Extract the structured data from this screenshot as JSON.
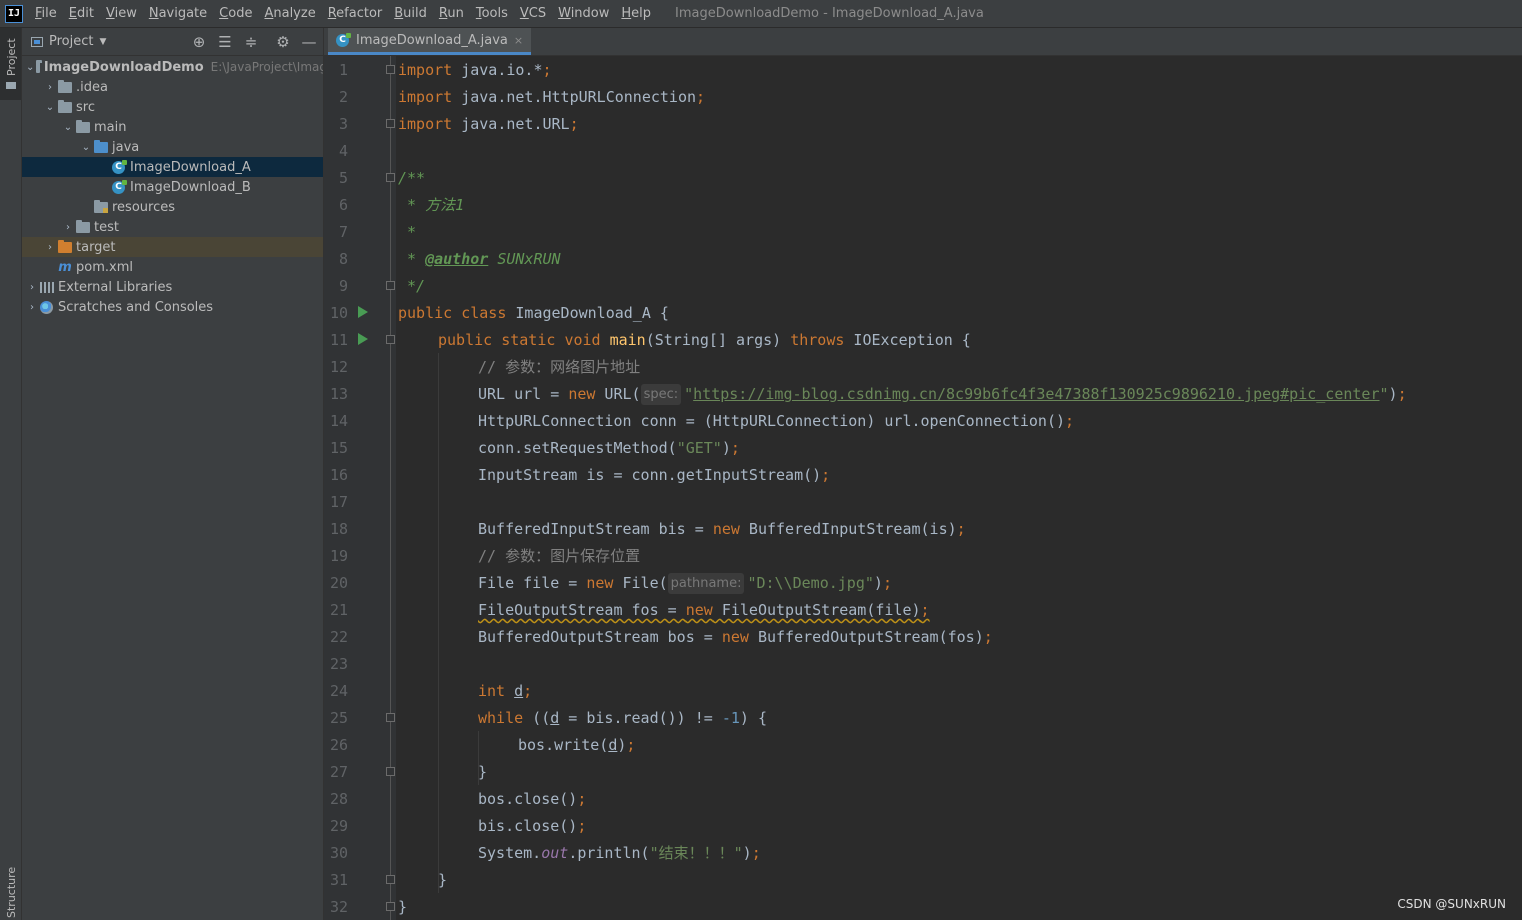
{
  "menu": {
    "app_logo": "IJ",
    "items": [
      "File",
      "Edit",
      "View",
      "Navigate",
      "Code",
      "Analyze",
      "Refactor",
      "Build",
      "Run",
      "Tools",
      "VCS",
      "Window",
      "Help"
    ],
    "window_title": "ImageDownloadDemo - ImageDownload_A.java"
  },
  "left_stripe": {
    "project_label": "Project",
    "structure_label": "Structure"
  },
  "project_panel": {
    "title": "Project",
    "tools": [
      "locate-icon",
      "expand-all-icon",
      "collapse-all-icon",
      "gear-icon",
      "hide-icon"
    ],
    "tree": [
      {
        "label": "ImageDownloadDemo",
        "path": "E:\\JavaProject\\Imag",
        "icon": "module-folder-icon",
        "expanded": true
      },
      {
        "label": ".idea",
        "icon": "folder-icon",
        "expanded": false
      },
      {
        "label": "src",
        "icon": "folder-icon",
        "expanded": true
      },
      {
        "label": "main",
        "icon": "folder-icon",
        "expanded": true
      },
      {
        "label": "java",
        "icon": "source-folder-icon",
        "expanded": true
      },
      {
        "label": "ImageDownload_A",
        "icon": "java-class-icon",
        "selected": true
      },
      {
        "label": "ImageDownload_B",
        "icon": "java-class-icon"
      },
      {
        "label": "resources",
        "icon": "resources-folder-icon"
      },
      {
        "label": "test",
        "icon": "folder-icon",
        "expanded": false
      },
      {
        "label": "target",
        "icon": "excluded-folder-icon",
        "expanded": false
      },
      {
        "label": "pom.xml",
        "icon": "maven-icon"
      },
      {
        "label": "External Libraries",
        "icon": "library-icon",
        "expanded": false
      },
      {
        "label": "Scratches and Consoles",
        "icon": "scratch-icon",
        "expanded": false
      }
    ]
  },
  "editor": {
    "tab": {
      "label": "ImageDownload_A.java",
      "close": "×"
    },
    "line_numbers": [
      "1",
      "2",
      "3",
      "4",
      "5",
      "6",
      "7",
      "8",
      "9",
      "10",
      "11",
      "12",
      "13",
      "14",
      "15",
      "16",
      "17",
      "18",
      "19",
      "20",
      "21",
      "22",
      "23",
      "24",
      "25",
      "26",
      "27",
      "28",
      "29",
      "30",
      "31",
      "32"
    ],
    "code": {
      "l1_kw": "import",
      "l1_rest": " java.io.*",
      "semi": ";",
      "l2_rest": " java.net.HttpURLConnection",
      "l3_rest": " java.net.URL",
      "l5": "/**",
      "l6": " * 方法1",
      "l7": " *",
      "l8_star": " * ",
      "l8_tag": "@author",
      "l8_name": " SUNxRUN",
      "l9": " */",
      "l10_kw1": "public",
      "l10_kw2": "class",
      "l10_name": " ImageDownload_A {",
      "l11_kw3": "static",
      "l11_kw4": "void",
      "l11_fn": "main",
      "l11_params": "(String[] args) ",
      "l11_throws": "throws",
      "l11_exc": " IOException {",
      "l12": "// 参数：网络图片地址",
      "l13_a": "URL url = ",
      "kw_new": "new",
      "l13_b": " URL(",
      "l13_hint": "spec:",
      "quote": "\"",
      "l13_url": "https://img-blog.csdnimg.cn/8c99b6fc4f3e47388f130925c9896210.jpeg#pic_center",
      "l13_end": ")",
      "l14": "HttpURLConnection conn = (HttpURLConnection) url.openConnection()",
      "l15_a": "conn.setRequestMethod(",
      "l15_str": "\"GET\"",
      "l15_end": ")",
      "l16": "InputStream is = conn.getInputStream()",
      "l18_a": "BufferedInputStream bis = ",
      "l18_b": " BufferedInputStream(is)",
      "l19": "// 参数：图片保存位置",
      "l20_a": "File file = ",
      "l20_b": " File(",
      "l20_hint": "pathname:",
      "l20_str": "\"D:\\\\Demo.jpg\"",
      "l20_end": ")",
      "l21_a": "FileOutputStream fos = ",
      "l21_b": " FileOutputStream(file)",
      "l22_a": "BufferedOutputStream bos = ",
      "l22_b": " BufferedOutputStream(fos)",
      "l24_kw": "int",
      "l24_var": "d",
      "l25_kw": "while",
      "l25_a": " ((",
      "l25_var": "d",
      "l25_b": " = bis.read()) != ",
      "l25_num": "-1",
      "l25_c": ") {",
      "l26_a": "bos.write(",
      "l26_var": "d",
      "l26_b": ")",
      "l27": "}",
      "l28": "bos.close()",
      "l29": "bis.close()",
      "l30_a": "System.",
      "l30_field": "out",
      "l30_b": ".println(",
      "l30_str": "\"结束！！！\"",
      "l30_c": ")",
      "l31": "}",
      "l32": "}"
    }
  },
  "watermark": "CSDN @SUNxRUN",
  "colors": {
    "keyword": "#cc7832",
    "string": "#6a8759",
    "number": "#6897bb",
    "comment": "#808080",
    "doc": "#629755",
    "function": "#ffc66d",
    "selection": "#0d293e"
  }
}
